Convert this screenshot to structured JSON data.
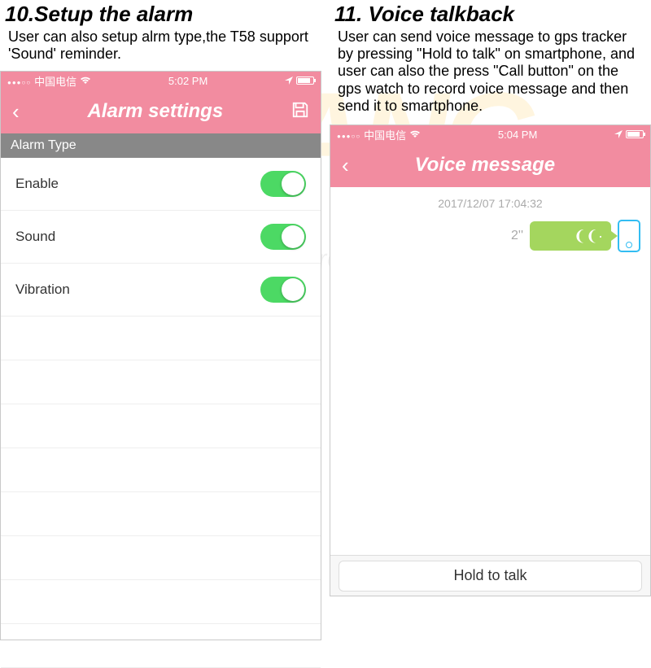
{
  "watermark": "YUANG",
  "watermark_sub": "electronics",
  "left": {
    "title": "10.Setup the alarm",
    "desc": "User can also setup alrm type,the T58 support 'Sound' reminder.",
    "status": {
      "carrier": "中国电信",
      "time": "5:02 PM"
    },
    "nav_title": "Alarm settings",
    "section": "Alarm Type",
    "rows": [
      {
        "label": "Enable",
        "on": true
      },
      {
        "label": "Sound",
        "on": true
      },
      {
        "label": "Vibration",
        "on": true
      }
    ]
  },
  "right": {
    "title": "11. Voice talkback",
    "desc": "User can send voice message to gps tracker by pressing \"Hold to talk\" on smartphone, and user can also the press \"Call button\" on the gps watch to record voice message and then send it to smartphone.",
    "status": {
      "carrier": "中国电信",
      "time": "5:04 PM"
    },
    "nav_title": "Voice message",
    "chat_date": "2017/12/07 17:04:32",
    "bubble_duration": "2''",
    "hold_label": "Hold to talk"
  }
}
